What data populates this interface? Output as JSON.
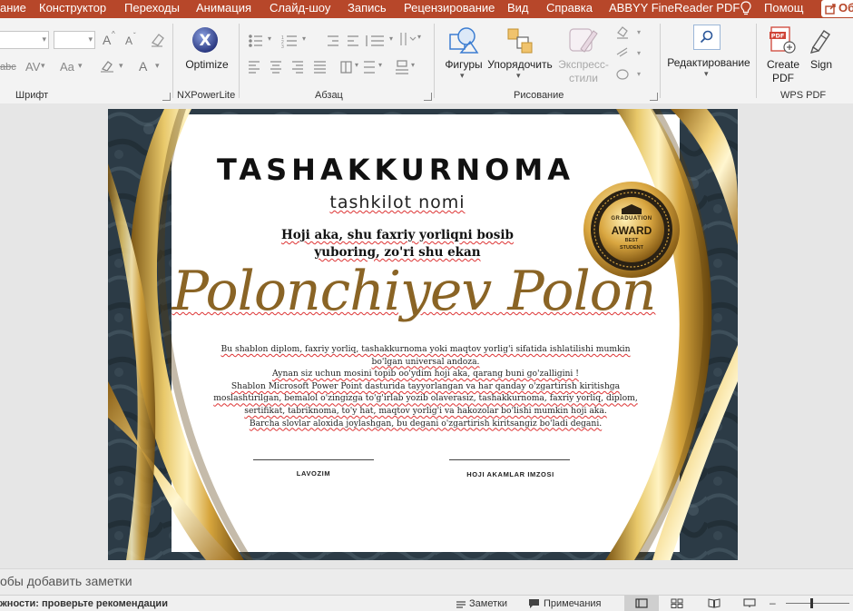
{
  "menu": {
    "items": [
      "ание",
      "Конструктор",
      "Переходы",
      "Анимация",
      "Слайд-шоу",
      "Запись",
      "Рецензирование",
      "Вид",
      "Справка",
      "ABBYY FineReader PDF",
      "Помощ"
    ],
    "share_label": "Об"
  },
  "ribbon": {
    "groups": {
      "font": "Шрифт",
      "nxpowerlite": "NXPowerLite",
      "paragraph": "Абзац",
      "drawing": "Рисование",
      "wps": "WPS PDF"
    },
    "buttons": {
      "optimize": "Optimize",
      "shapes": "Фигуры",
      "arrange": "Упорядочить",
      "styles_line1": "Экспресс-",
      "styles_line2": "стили",
      "editing": "Редактирование",
      "create_pdf_line1": "Create",
      "create_pdf_line2": "PDF",
      "sign": "Sign"
    },
    "font_tools": {
      "grow": "A",
      "shrink": "A",
      "abc": "abc",
      "av": "AV",
      "aa": "Aa",
      "font_color": "A"
    }
  },
  "slide": {
    "title": "TASHAKKURNOMA",
    "org": "tashkilot nomi",
    "greeting_line1": "Hoji aka, shu faxriy yorliqni bosib",
    "greeting_line2": "yuboring, zo'ri shu ekan",
    "name": "Polonchiyev Polon",
    "body_lines": [
      "Bu shablon diplom, faxriy yorliq, tashakkurnoma yoki maqtov yorlig'i sifatida ishlatilishi mumkin",
      "bo'lgan universal andoza.",
      "Aynan siz uchun mosini topib oo'ydim hoji aka, qarang buni go'zalligini !",
      "Shablon Microsoft Power Point dasturida tayyorlangan va har qanday o'zgartirish kiritishga",
      "moslashtirilgan, bemalol o'zingizga to'g'irlab yozib olaverasiz, tashakkurnoma, faxriy yorliq, diplom,",
      "sertifikat, tabriknoma, to'y hat, maqtov yorlig'i va hakozolar bo'lishi mumkin hoji aka.",
      "Barcha slovlar aloxida joylashgan, bu degani o'zgartirish kiritsangiz bo'ladi degani."
    ],
    "signature_left": "LAVOZIM",
    "signature_right": "HOJI AKAMLAR IMZOSI",
    "badge": {
      "line1": "GRADUATION",
      "line2": "AWARD",
      "line3": "BEST",
      "line4": "STUDENT"
    }
  },
  "notes": {
    "placeholder": "обы добавить заметки"
  },
  "status": {
    "accessibility": "жности: проверьте рекомендации",
    "notes_button": "Заметки",
    "comments_button": "Примечания"
  },
  "colors": {
    "accent": "#b7472a",
    "gold": "#c9962e",
    "dark_bg": "#2b3a45"
  }
}
